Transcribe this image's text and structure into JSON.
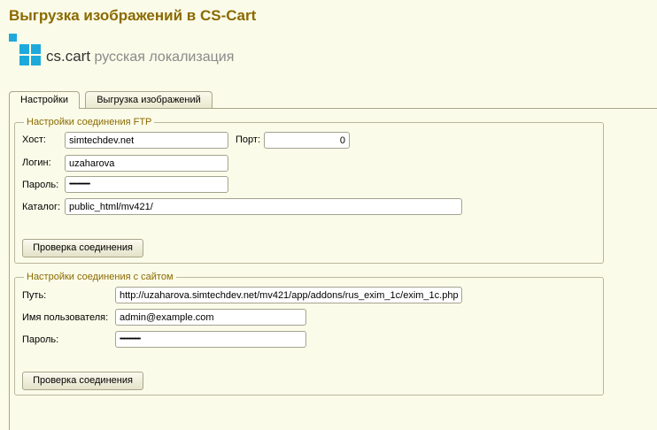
{
  "window": {
    "title": "Выгрузка изображений в CS-Cart"
  },
  "logo": {
    "brand": "cs.cart",
    "tagline": "русская локализация",
    "accent_color": "#1ea9dc"
  },
  "tabs": [
    {
      "label": "Настройки",
      "active": true
    },
    {
      "label": "Выгрузка изображений",
      "active": false
    }
  ],
  "ftp": {
    "legend": "Настройки соединения FTP",
    "host_label": "Хост:",
    "host_value": "simtechdev.net",
    "port_label": "Порт:",
    "port_value": "0",
    "login_label": "Логин:",
    "login_value": "uzaharova",
    "password_label": "Пароль:",
    "password_value": "••••••••••••••••",
    "catalog_label": "Каталог:",
    "catalog_value": "public_html/mv421/",
    "check_button": "Проверка соединения"
  },
  "site": {
    "legend": "Настройки соединения с сайтом",
    "path_label": "Путь:",
    "path_value": "http://uzaharova.simtechdev.net/mv421/app/addons/rus_exim_1c/exim_1c.php",
    "user_label": "Имя пользователя:",
    "user_value": "admin@example.com",
    "password_label": "Пароль:",
    "password_value": "••••••••••••••••",
    "check_button": "Проверка соединения"
  }
}
